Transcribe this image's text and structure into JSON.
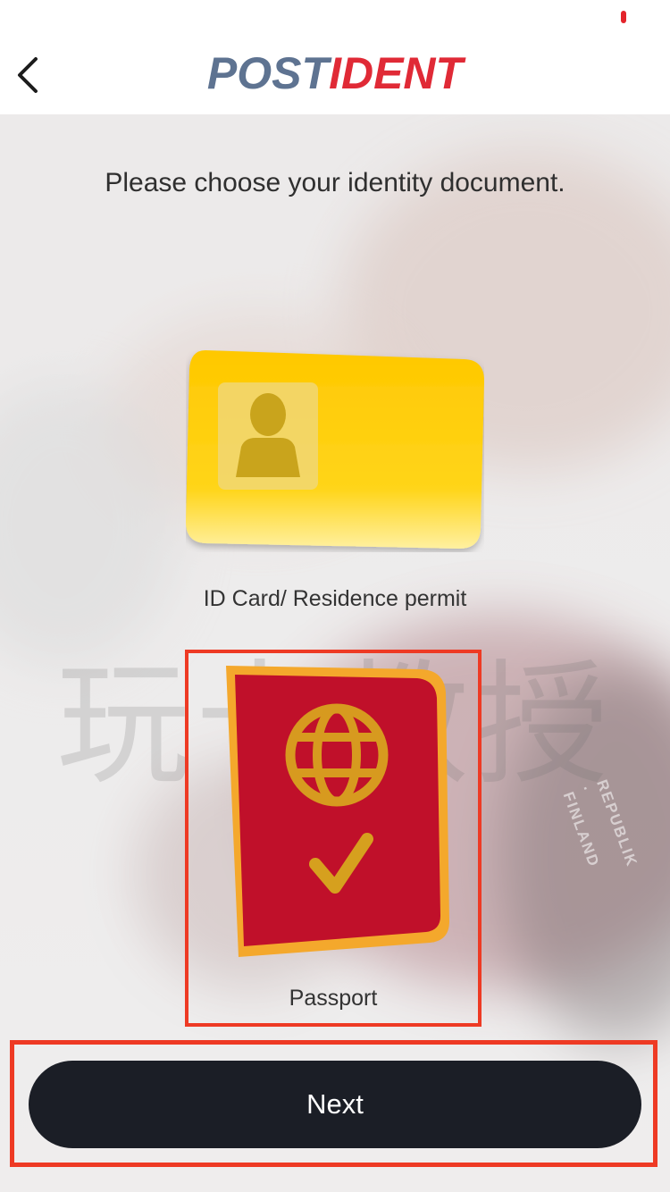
{
  "header": {
    "back_icon": "chevron-left-icon",
    "logo_part1": "POST",
    "logo_part2": "IDENT",
    "logo_colors": {
      "post": "#5e7391",
      "ident": "#e02a36"
    }
  },
  "main": {
    "instruction": "Please choose your identity document.",
    "options": [
      {
        "label": "ID Card/ Residence permit",
        "icon": "id-card-icon",
        "selected": false
      },
      {
        "label": "Passport",
        "icon": "passport-icon",
        "selected": true
      }
    ]
  },
  "watermark": "玩卡教授",
  "background_passport_text": "REPUBLIK · FINLAND",
  "footer": {
    "next_label": "Next"
  },
  "colors": {
    "accent_red": "#ee3a24",
    "button_dark": "#1b1e26",
    "id_card_yellow": "#ffcc00",
    "passport_red": "#c0102a",
    "passport_gold": "#f0a830"
  }
}
